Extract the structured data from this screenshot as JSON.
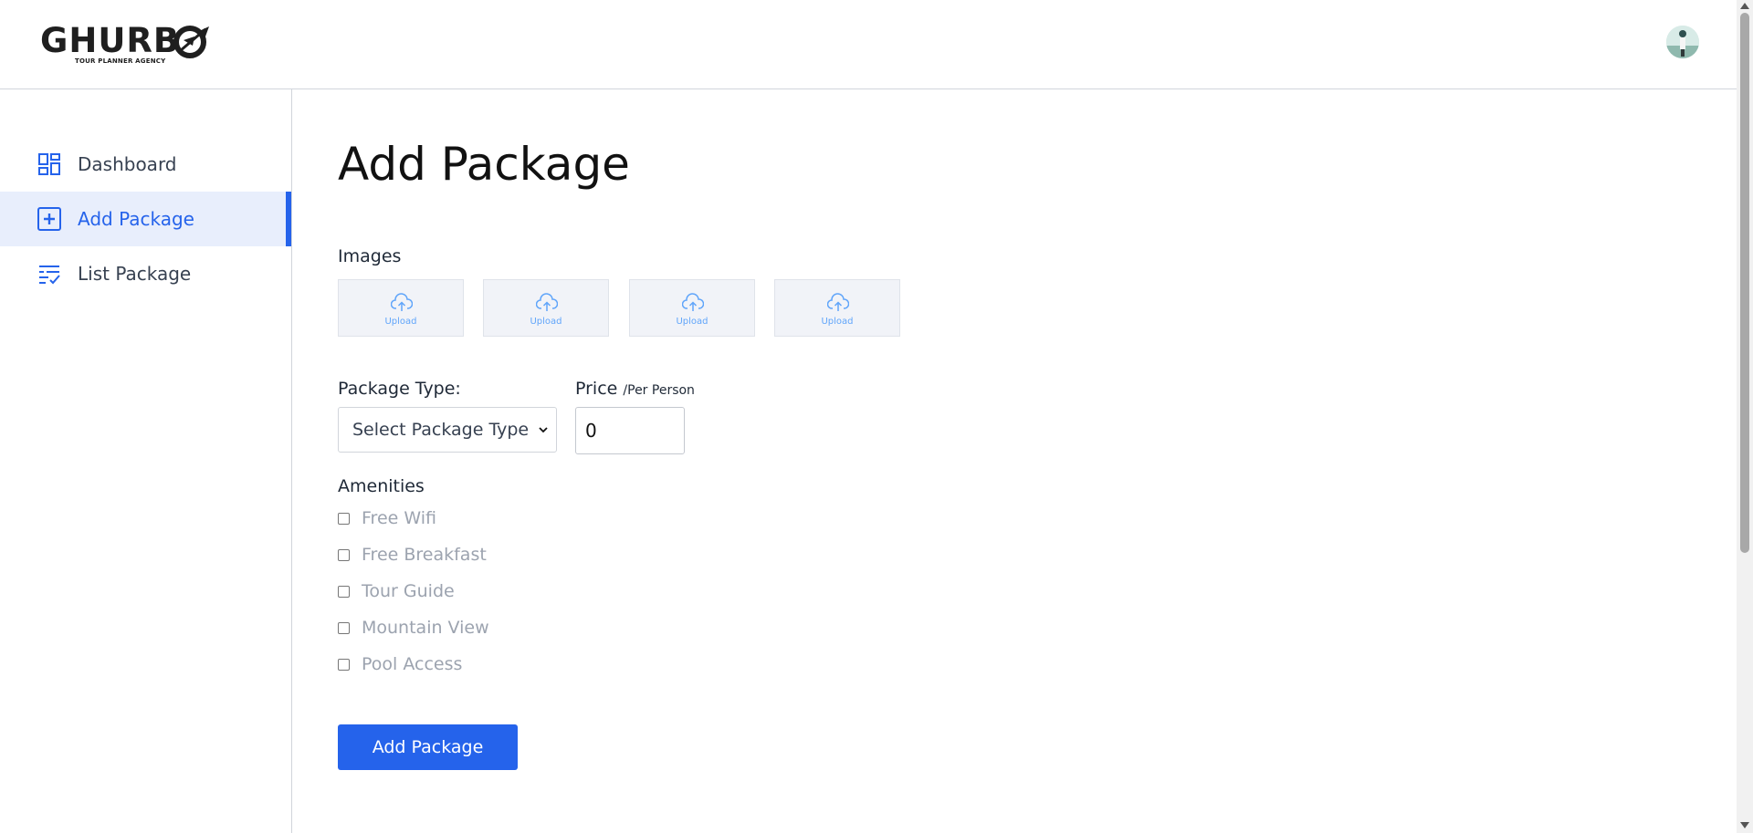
{
  "brand": {
    "name": "GHURB",
    "tagline": "TOUR PLANNER AGENCY"
  },
  "header": {
    "avatar_icon": "user-avatar"
  },
  "sidebar": {
    "items": [
      {
        "label": "Dashboard",
        "icon": "dashboard-icon",
        "active": false
      },
      {
        "label": "Add Package",
        "icon": "add-square-icon",
        "active": true
      },
      {
        "label": "List Package",
        "icon": "list-check-icon",
        "active": false
      }
    ]
  },
  "main": {
    "title": "Add Package",
    "images": {
      "label": "Images",
      "uploads": [
        {
          "label": "Upload"
        },
        {
          "label": "Upload"
        },
        {
          "label": "Upload"
        },
        {
          "label": "Upload"
        }
      ]
    },
    "package_type": {
      "label": "Package Type:",
      "selected": "Select Package Type"
    },
    "price": {
      "label": "Price",
      "unit": "/Per Person",
      "value": "0"
    },
    "amenities": {
      "label": "Amenities",
      "items": [
        {
          "label": "Free Wifi",
          "checked": false
        },
        {
          "label": "Free Breakfast",
          "checked": false
        },
        {
          "label": "Tour Guide",
          "checked": false
        },
        {
          "label": "Mountain View",
          "checked": false
        },
        {
          "label": "Pool Access",
          "checked": false
        }
      ]
    },
    "submit_label": "Add Package"
  },
  "colors": {
    "accent": "#2563eb",
    "active_bg": "#e8eefc",
    "muted_text": "#9ca3af"
  }
}
